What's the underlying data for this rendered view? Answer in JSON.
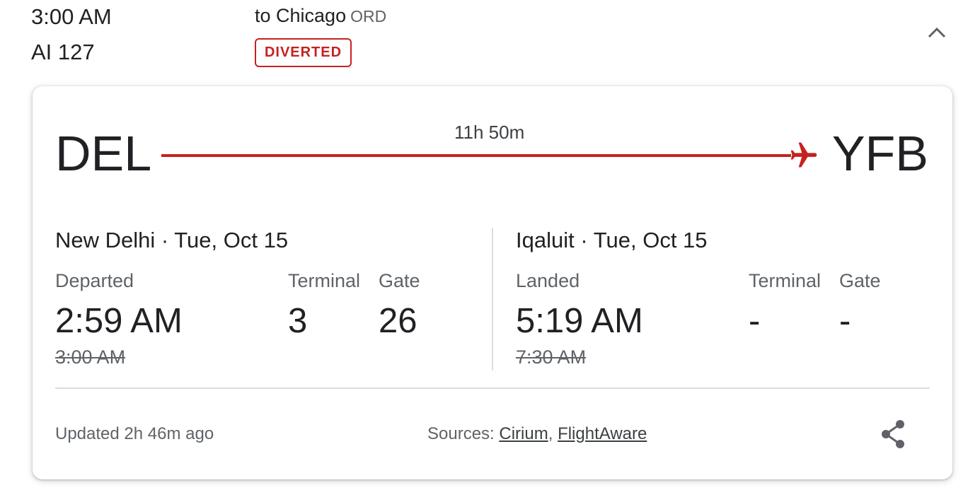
{
  "header": {
    "departure_time": "3:00 AM",
    "flight_number": "AI 127",
    "destination_prefix": "to Chicago",
    "destination_code": "ORD",
    "status_badge": "DIVERTED"
  },
  "route": {
    "origin_code": "DEL",
    "destination_code": "YFB",
    "duration": "11h 50m"
  },
  "departure": {
    "city_date": "New Delhi · Tue, Oct 15",
    "status_label": "Departed",
    "actual_time": "2:59 AM",
    "scheduled_time": "3:00 AM",
    "terminal_label": "Terminal",
    "terminal": "3",
    "gate_label": "Gate",
    "gate": "26"
  },
  "arrival": {
    "city_date": "Iqaluit · Tue, Oct 15",
    "status_label": "Landed",
    "actual_time": "5:19 AM",
    "scheduled_time": "7:30 AM",
    "terminal_label": "Terminal",
    "terminal": "-",
    "gate_label": "Gate",
    "gate": "-"
  },
  "footer": {
    "updated": "Updated 2h 46m ago",
    "sources_label": "Sources:",
    "source_1": "Cirium",
    "separator": ",",
    "source_2": "FlightAware"
  },
  "icons": {
    "collapse": "chevron-up-icon",
    "plane": "airplane-icon",
    "share": "share-icon"
  },
  "colors": {
    "status_red": "#c5221f",
    "text_primary": "#202124",
    "text_secondary": "#5f6368"
  }
}
